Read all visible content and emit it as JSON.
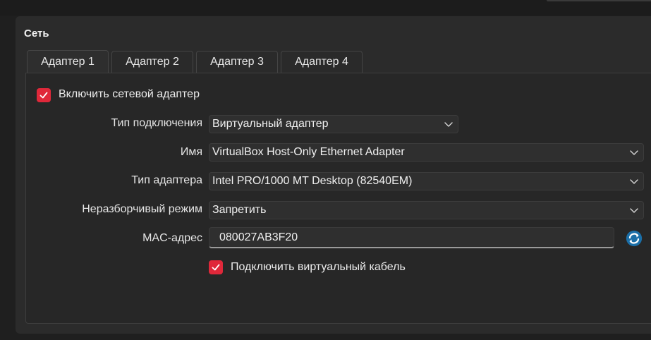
{
  "section": {
    "title": "Сеть"
  },
  "tabs": [
    {
      "label": "Адаптер 1",
      "active": true
    },
    {
      "label": "Адаптер 2",
      "active": false
    },
    {
      "label": "Адаптер 3",
      "active": false
    },
    {
      "label": "Адаптер 4",
      "active": false
    }
  ],
  "enable_adapter": {
    "label": "Включить сетевой адаптер",
    "checked": true
  },
  "fields": {
    "connection_type": {
      "label": "Тип подключения",
      "value": "Виртуальный адаптер"
    },
    "name": {
      "label": "Имя",
      "value": "VirtualBox Host-Only Ethernet Adapter"
    },
    "adapter_type": {
      "label": "Тип адаптера",
      "value": "Intel PRO/1000 MT Desktop (82540EM)"
    },
    "promiscuous_mode": {
      "label": "Неразборчивый режим",
      "value": "Запретить"
    },
    "mac_address": {
      "label": "MAC-адрес",
      "value": "080027AB3F20"
    }
  },
  "cable_connected": {
    "label": "Подключить виртуальный кабель",
    "checked": true
  },
  "colors": {
    "accent": "#e0283a",
    "refresh_icon": "#29a8e0",
    "background": "#2b2b2b"
  },
  "icons": {
    "checkbox_check": "check-icon",
    "dropdown": "chevron-down-icon",
    "mac_refresh": "refresh-icon"
  }
}
